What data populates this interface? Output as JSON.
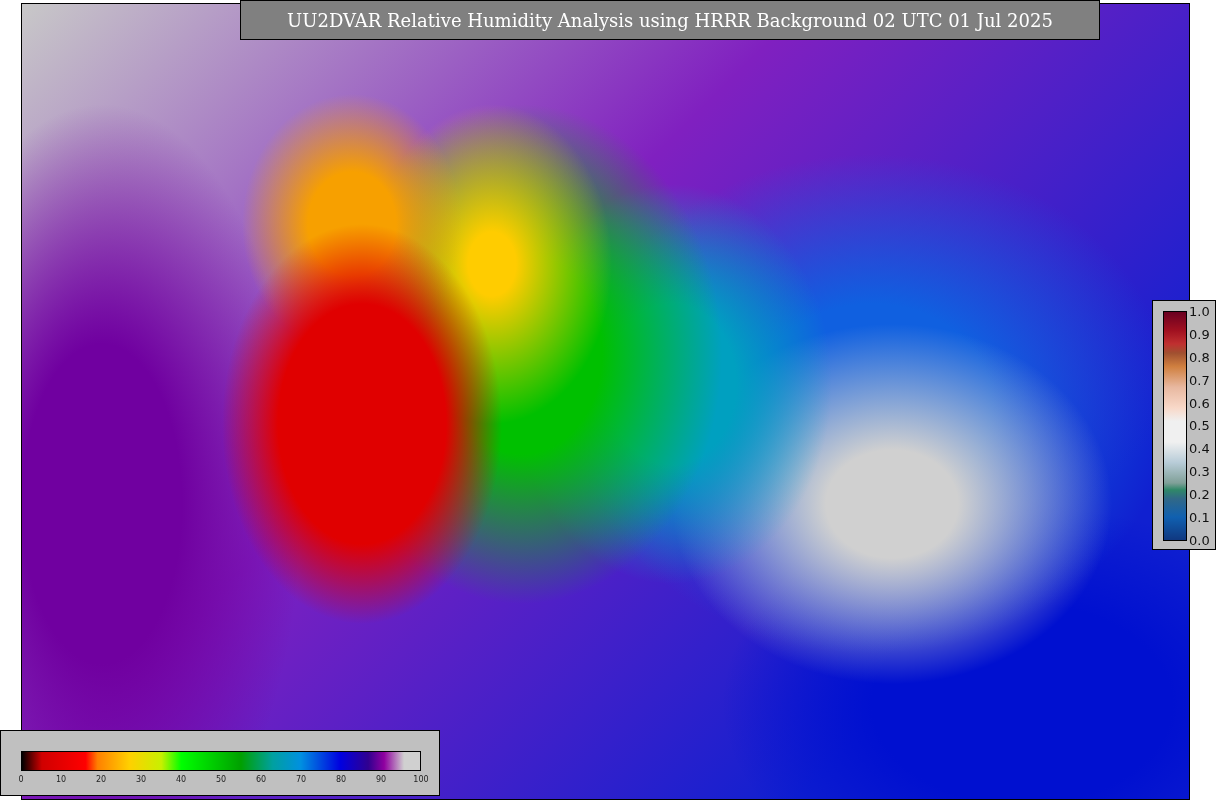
{
  "title": "UU2DVAR Relative Humidity Analysis using HRRR Background 02 UTC 01 Jul 2025",
  "humidity_colorbar": {
    "ticks": [
      "0",
      "10",
      "20",
      "30",
      "40",
      "50",
      "60",
      "70",
      "80",
      "90",
      "100"
    ]
  },
  "ratio_colorbar": {
    "ticks": [
      "1.0",
      "0.9",
      "0.8",
      "0.7",
      "0.6",
      "0.5",
      "0.4",
      "0.3",
      "0.2",
      "0.1",
      "0.0"
    ]
  }
}
